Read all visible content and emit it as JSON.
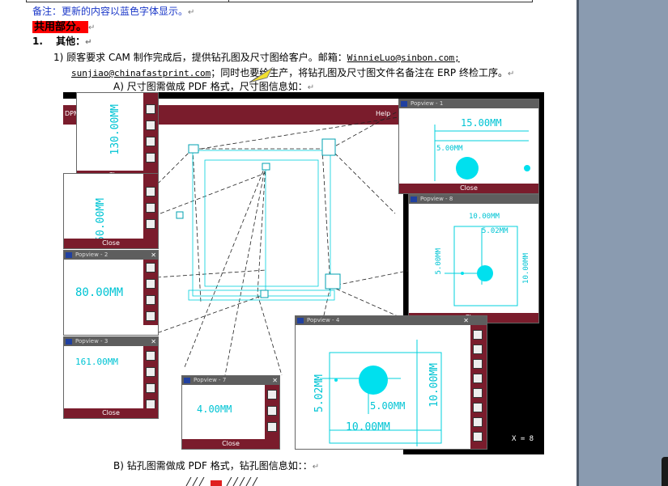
{
  "doc": {
    "note": "备注：更新的内容以蓝色字体显示。",
    "common_section": "共用部分。",
    "item_number": "1.",
    "item_title": "其他：",
    "para1_prefix": "1)  顾客要求 CAM 制作完成后，提供钻孔图及尺寸图给客户。邮箱：",
    "email1": "WinnieLuo@sinbon.com;",
    "email2": "sunjiao@chinafastprint.com",
    "para1_suffix": "；同时也要给生产，将钻孔图及尺寸图文件名备注在 ERP 终检工序。",
    "sub_a": "A)  尺寸图需做成 PDF 格式，尺寸图信息如：",
    "sub_b": "B)  钻孔图需做成 PDF 格式，钻孔图信息如：：",
    "return_mark": "↵"
  },
  "cad": {
    "menu_help": "Help",
    "menu_left": "DPM",
    "close_label": "Close",
    "popview_title": "Popview",
    "windows": [
      {
        "id": "1",
        "dims": [
          "15.00MM",
          "5.00MM"
        ]
      },
      {
        "id": "8",
        "dims": [
          "10.00MM",
          "5.02MM",
          "5.00MM",
          "10.00MM"
        ]
      },
      {
        "id": "4",
        "dims": [
          "5.02MM",
          "5.00MM",
          "10.00MM",
          "10.00MM"
        ]
      },
      {
        "id": "2",
        "dims": [
          "80.00MM"
        ]
      },
      {
        "id": "3",
        "dims": [
          "161.00MM"
        ]
      },
      {
        "id": "7",
        "dims": [
          "4.00MM"
        ]
      },
      {
        "id": "top-left",
        "dims": [
          "130.00MM"
        ]
      },
      {
        "id": "mid-left",
        "dims": [
          "50.00MM"
        ]
      }
    ],
    "coord_readout": "X = 8",
    "colors": {
      "accent_cyan": "#00e0ee",
      "frame_maroon": "#7a1c2c",
      "background": "#000000"
    }
  }
}
